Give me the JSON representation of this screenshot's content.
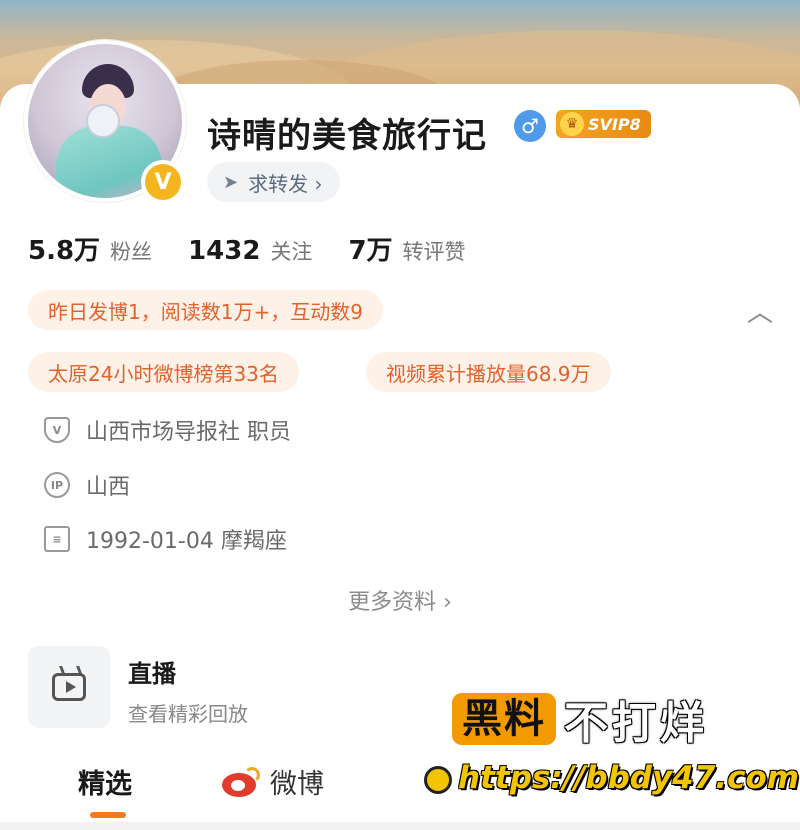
{
  "profile": {
    "name": "诗晴的美食旅行记",
    "gender_symbol": "♂",
    "vip_label": "SVIP8",
    "verified_mark": "V",
    "repost_button": "求转发 ›"
  },
  "stats": [
    {
      "value": "5.8万",
      "label": "粉丝"
    },
    {
      "value": "1432",
      "label": "关注"
    },
    {
      "value": "7万",
      "label": "转评赞"
    }
  ],
  "highlights": {
    "yesterday": "昨日发博1，阅读数1万+，互动数9",
    "ranking": "太原24小时微博榜第33名",
    "video_plays": "视频累计播放量68.9万"
  },
  "info": {
    "work": "山西市场导报社 职员",
    "ip_badge": "IP",
    "ip_location": "山西",
    "birthday": "1992-01-04 摩羯座"
  },
  "more_info": "更多资料 ›",
  "live": {
    "title": "直播",
    "subtitle": "查看精彩回放"
  },
  "tabs": [
    {
      "label": "精选"
    },
    {
      "label": "微博"
    }
  ],
  "watermark": {
    "left_text": "黑料",
    "right_text": "不打烊",
    "url": "https://bbdy47.com"
  },
  "colors": {
    "accent": "#f5791f",
    "pill_bg": "#fdf1e8",
    "pill_text": "#e2622d",
    "verified": "#f5b51f",
    "gender": "#4f9bea"
  }
}
